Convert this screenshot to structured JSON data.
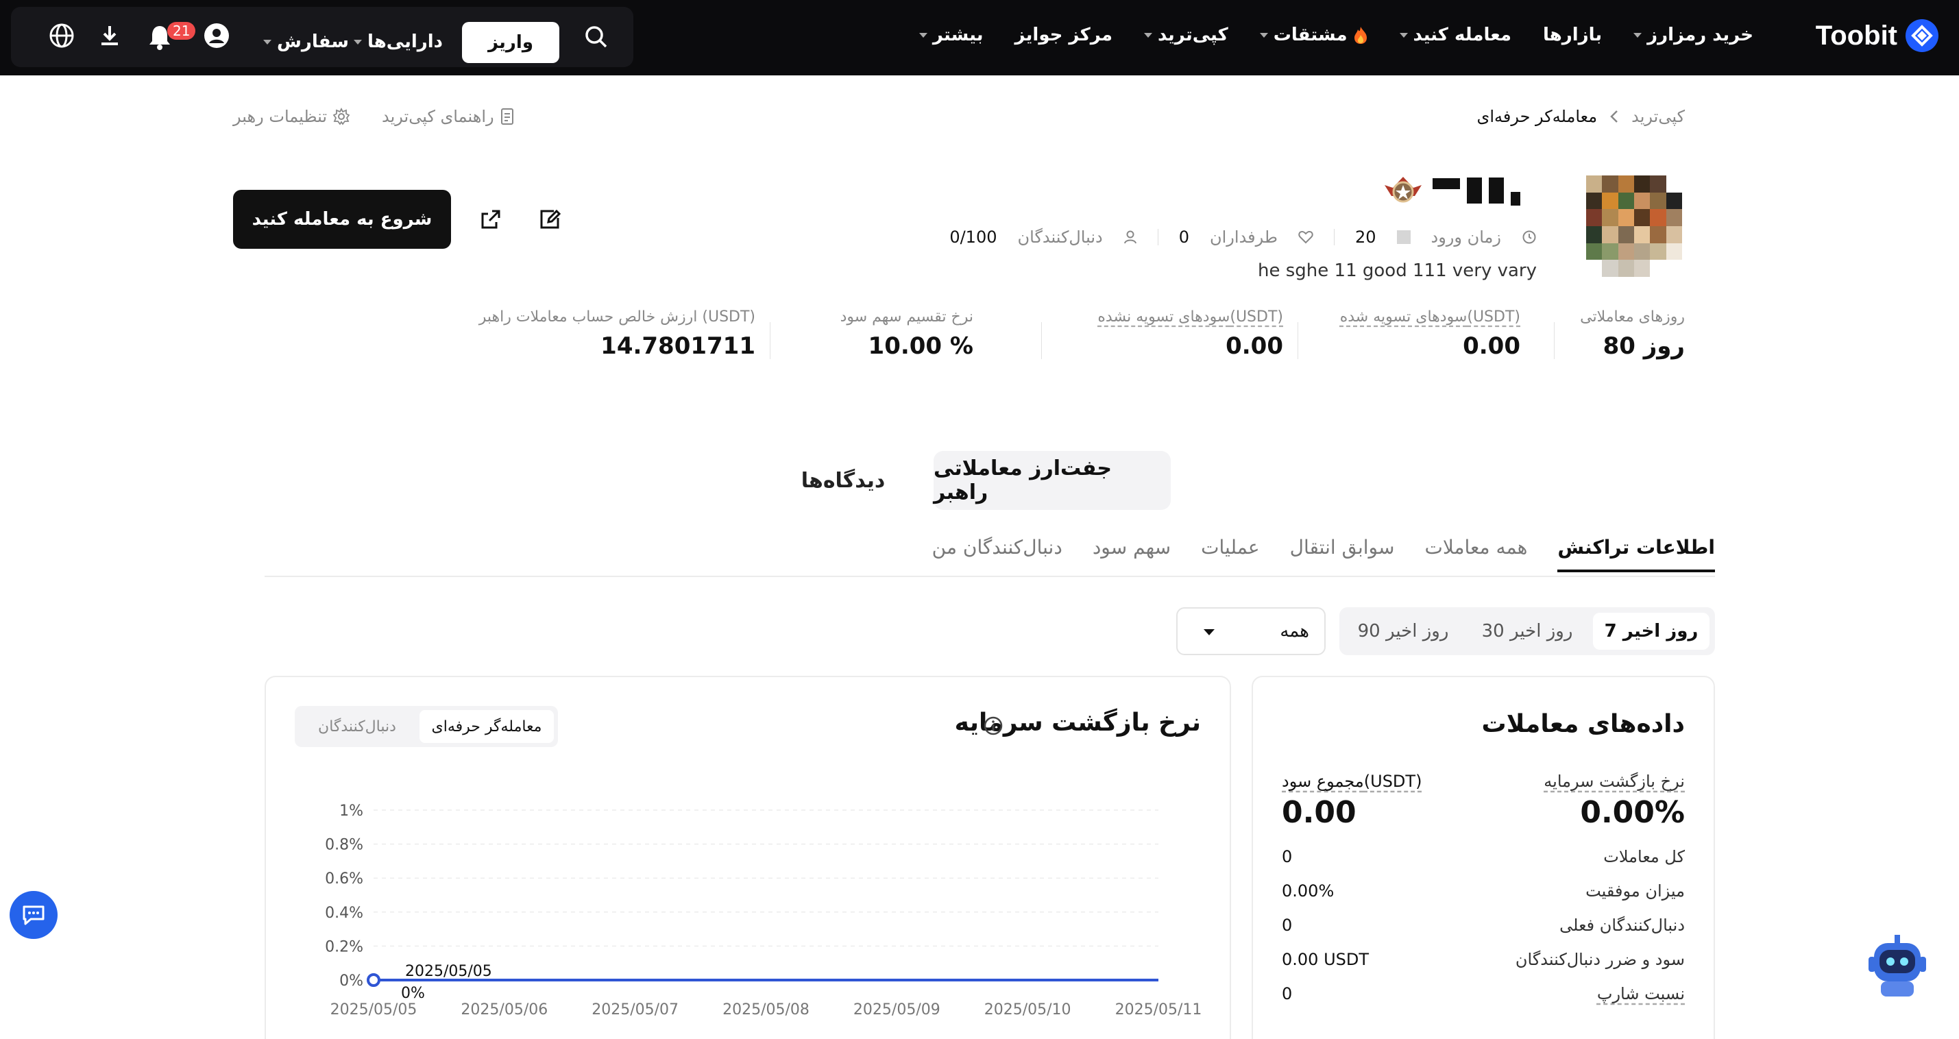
{
  "nav": {
    "brand": "Toobit",
    "items": [
      {
        "label": "خرید رمزارز",
        "caret": true
      },
      {
        "label": "بازارها",
        "caret": false
      },
      {
        "label": "معامله کنید",
        "caret": true
      },
      {
        "label": "مشتقات",
        "caret": true,
        "fire": true
      },
      {
        "label": "کپی‌ترید",
        "caret": true
      },
      {
        "label": "مرکز جوایز",
        "caret": false
      },
      {
        "label": "بیشتر",
        "caret": true
      }
    ],
    "deposit": "واریز",
    "assets": "دارایی‌ها",
    "orders": "سفارش",
    "notification_count": "21"
  },
  "breadcrumb": {
    "root": "کپی‌ترید",
    "current": "معامله‌کر حرفه‌ای"
  },
  "top_links": {
    "guide": "راهنمای کپی‌ترید",
    "settings": "تنظیمات رهبر"
  },
  "profile": {
    "join_label": "زمان ورود",
    "join_value": "20",
    "fans_label": "طرفداران",
    "fans_value": "0",
    "followers_label": "دنبال‌کنندگان",
    "followers_value": "0/100",
    "bio": "he sghe 11 good 111 very vary",
    "start_button": "شروع به معامله کنید"
  },
  "stats": [
    {
      "label": "روزهای معاملاتی",
      "value": "80 روز",
      "dashed": false
    },
    {
      "label": "سودهای تسویه شده(USDT)",
      "value": "0.00",
      "dashed": true
    },
    {
      "label": "سودهای تسویه نشده(USDT)",
      "value": "0.00",
      "dashed": true
    },
    {
      "label": "نرخ تقسیم سهم سود",
      "value": "10.00 %",
      "dashed": false
    },
    {
      "label": "ارزش خالص حساب معاملات راهبر (USDT)",
      "value": "14.7801711",
      "dashed": false
    }
  ],
  "segments": {
    "active": "جفت‌ارز معاملاتی راهبر",
    "other": "دیدگاه‌ها"
  },
  "subtabs": [
    "اطلاعات تراکنش",
    "همه معاملات",
    "سوابق انتقال",
    "عملیات",
    "سهم سود",
    "دنبال‌کنندگان من"
  ],
  "ranges": [
    "7 روز اخیر",
    "30 روز اخیر",
    "90 روز اخیر"
  ],
  "select_value": "همه",
  "trading_data": {
    "title": "داده‌های معاملات",
    "roi_label": "نرخ بازگشت سرمایه",
    "roi_value": "0.00%",
    "profit_label": "مجموع سود(USDT)",
    "profit_value": "0.00",
    "rows": [
      {
        "label": "کل معاملات",
        "value": "0"
      },
      {
        "label": "میزان موفقیت",
        "value": "0.00%"
      },
      {
        "label": "دنبال‌کنندگان فعلی",
        "value": "0"
      },
      {
        "label": "سود و ضرر دنبال‌کنندگان",
        "value": "0.00 USDT"
      },
      {
        "label": "نسبت شارپ",
        "value": "0"
      }
    ]
  },
  "roi_chart": {
    "title": "نرخ بازگشت سرمایه",
    "toggle_active": "معامله‌گر حرفه‌ای",
    "toggle_other": "دنبال‌کنندگان",
    "tooltip_date": "2025/05/05",
    "tooltip_value": "0%"
  },
  "chart_data": {
    "type": "line",
    "x": [
      "2025/05/05",
      "2025/05/06",
      "2025/05/07",
      "2025/05/08",
      "2025/05/09",
      "2025/05/10",
      "2025/05/11"
    ],
    "yticks": [
      "1%",
      "0.8%",
      "0.6%",
      "0.4%",
      "0.2%",
      "0%"
    ],
    "ylim": [
      0,
      1
    ],
    "series": [
      {
        "values": [
          0,
          0,
          0,
          0,
          0,
          0,
          0
        ]
      }
    ],
    "line_color": "#2f55d4",
    "grid": true
  },
  "colors": {
    "topbar": "#0b0b0d",
    "accent": "#1f5cff",
    "badge": "#f04a4a"
  }
}
